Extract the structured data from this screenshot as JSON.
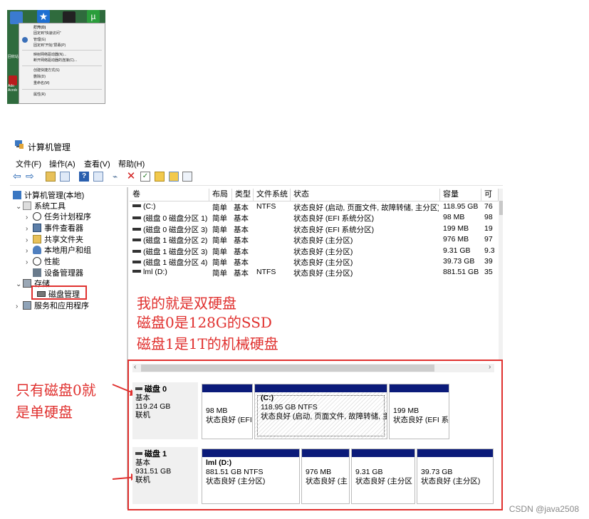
{
  "context_menu": {
    "items": [
      "打开(O)",
      "固定到\"快速访问\"",
      "管理(G)",
      "固定到\"开始\"屏幕(P)",
      "映射网络驱动器(N)...",
      "断开网络驱动器的连接(C)...",
      "创建快捷方式(S)",
      "删除(D)",
      "重命名(M)",
      "属性(R)"
    ],
    "desktop_labels": [
      "回收站",
      "Ado",
      "Acrob"
    ]
  },
  "window": {
    "title": "计算机管理",
    "menu": [
      "文件(F)",
      "操作(A)",
      "查看(V)",
      "帮助(H)"
    ]
  },
  "tree": {
    "root": "计算机管理(本地)",
    "system_tools": "系统工具",
    "items": [
      "任务计划程序",
      "事件查看器",
      "共享文件夹",
      "本地用户和组",
      "性能",
      "设备管理器"
    ],
    "storage": "存储",
    "disk_mgmt": "磁盘管理",
    "services": "服务和应用程序"
  },
  "volume_table": {
    "headers": [
      "卷",
      "布局",
      "类型",
      "文件系统",
      "状态",
      "容量",
      "可"
    ],
    "rows": [
      {
        "vol": "(C:)",
        "layout": "简单",
        "type": "基本",
        "fs": "NTFS",
        "status": "状态良好 (启动, 页面文件, 故障转储, 主分区)",
        "cap": "118.95 GB",
        "free": "76"
      },
      {
        "vol": "(磁盘 0 磁盘分区 1)",
        "layout": "简单",
        "type": "基本",
        "fs": "",
        "status": "状态良好 (EFI 系统分区)",
        "cap": "98 MB",
        "free": "98"
      },
      {
        "vol": "(磁盘 0 磁盘分区 3)",
        "layout": "简单",
        "type": "基本",
        "fs": "",
        "status": "状态良好 (EFI 系统分区)",
        "cap": "199 MB",
        "free": "19"
      },
      {
        "vol": "(磁盘 1 磁盘分区 2)",
        "layout": "简单",
        "type": "基本",
        "fs": "",
        "status": "状态良好 (主分区)",
        "cap": "976 MB",
        "free": "97"
      },
      {
        "vol": "(磁盘 1 磁盘分区 3)",
        "layout": "简单",
        "type": "基本",
        "fs": "",
        "status": "状态良好 (主分区)",
        "cap": "9.31 GB",
        "free": "9.3"
      },
      {
        "vol": "(磁盘 1 磁盘分区 4)",
        "layout": "简单",
        "type": "基本",
        "fs": "",
        "status": "状态良好 (主分区)",
        "cap": "39.73 GB",
        "free": "39"
      },
      {
        "vol": "lml (D:)",
        "layout": "简单",
        "type": "基本",
        "fs": "NTFS",
        "status": "状态良好 (主分区)",
        "cap": "881.51 GB",
        "free": "35"
      }
    ]
  },
  "annotations": {
    "line1": "我的就是双硬盘",
    "line2": "磁盘0是128G的SSD",
    "line3": "磁盘1是1T的机械硬盘",
    "side1": "只有磁盘0就",
    "side2": "是单硬盘"
  },
  "disks": {
    "disk0": {
      "name": "磁盘 0",
      "type": "基本",
      "size": "119.24 GB",
      "status": "联机",
      "partitions": [
        {
          "name": "",
          "size": "98 MB",
          "status": "状态良好 (EFI"
        },
        {
          "name": "(C:)",
          "size": "118.95 GB NTFS",
          "status": "状态良好 (启动, 页面文件, 故障转储, 主"
        },
        {
          "name": "",
          "size": "199 MB",
          "status": "状态良好 (EFI 系"
        }
      ]
    },
    "disk1": {
      "name": "磁盘 1",
      "type": "基本",
      "size": "931.51 GB",
      "status": "联机",
      "partitions": [
        {
          "name": "lml  (D:)",
          "size": "881.51 GB NTFS",
          "status": "状态良好 (主分区)"
        },
        {
          "name": "",
          "size": "976 MB",
          "status": "状态良好 (主"
        },
        {
          "name": "",
          "size": "9.31 GB",
          "status": "状态良好 (主分区"
        },
        {
          "name": "",
          "size": "39.73 GB",
          "status": "状态良好 (主分区)"
        }
      ]
    }
  },
  "watermark": "CSDN @java2508",
  "colors": {
    "annotation": "#e0312f",
    "partition_bar": "#0b1b7a"
  }
}
